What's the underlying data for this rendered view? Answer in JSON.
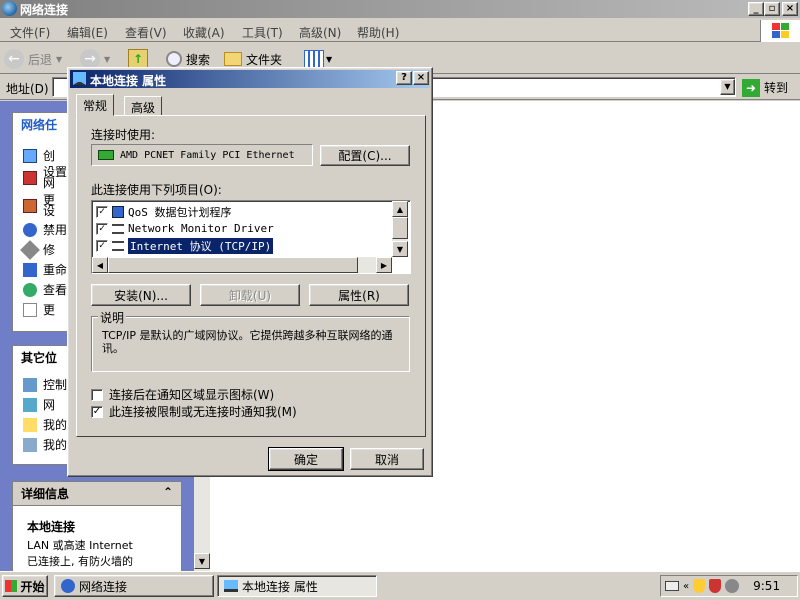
{
  "window": {
    "title": "网络连接"
  },
  "menu": [
    "文件(F)",
    "编辑(E)",
    "查看(V)",
    "收藏(A)",
    "工具(T)",
    "高级(N)",
    "帮助(H)"
  ],
  "toolbar": {
    "back": "后退",
    "search": "搜索",
    "folders": "文件夹"
  },
  "address": {
    "label": "地址(D)",
    "go": "转到"
  },
  "left": {
    "network_tasks": "网络任",
    "tasks": [
      "创",
      "设置\n网",
      "更\n设",
      "禁用",
      "修",
      "重命",
      "查看",
      "更"
    ],
    "other_places": "其它位",
    "places": [
      "控制",
      "网",
      "我的",
      "我的"
    ],
    "details": "详细信息",
    "details_name": "本地连接",
    "details_line1": "LAN 或高速 Internet",
    "details_line2": "已连接上, 有防火墙的"
  },
  "dialog": {
    "title": "本地连接 属性",
    "tab_general": "常规",
    "tab_advanced": "高级",
    "connect_using": "连接时使用:",
    "adapter": "AMD PCNET Family PCI Ethernet",
    "configure": "配置(C)...",
    "items_label": "此连接使用下列项目(O):",
    "items": [
      {
        "label": "QoS 数据包计划程序",
        "checked": true
      },
      {
        "label": "Network Monitor Driver",
        "checked": true
      },
      {
        "label": "Internet 协议 (TCP/IP)",
        "checked": true
      }
    ],
    "install": "安装(N)...",
    "uninstall": "卸载(U)",
    "properties": "属性(R)",
    "desc_title": "说明",
    "desc_text": "TCP/IP 是默认的广域网协议。它提供跨越多种互联网络的通讯。",
    "show_icon": "连接后在通知区域显示图标(W)",
    "show_icon_checked": false,
    "notify": "此连接被限制或无连接时通知我(M)",
    "notify_checked": true,
    "ok": "确定",
    "cancel": "取消"
  },
  "taskbar": {
    "start": "开始",
    "task1": "网络连接",
    "task2": "本地连接 属性",
    "time": "9:51"
  }
}
